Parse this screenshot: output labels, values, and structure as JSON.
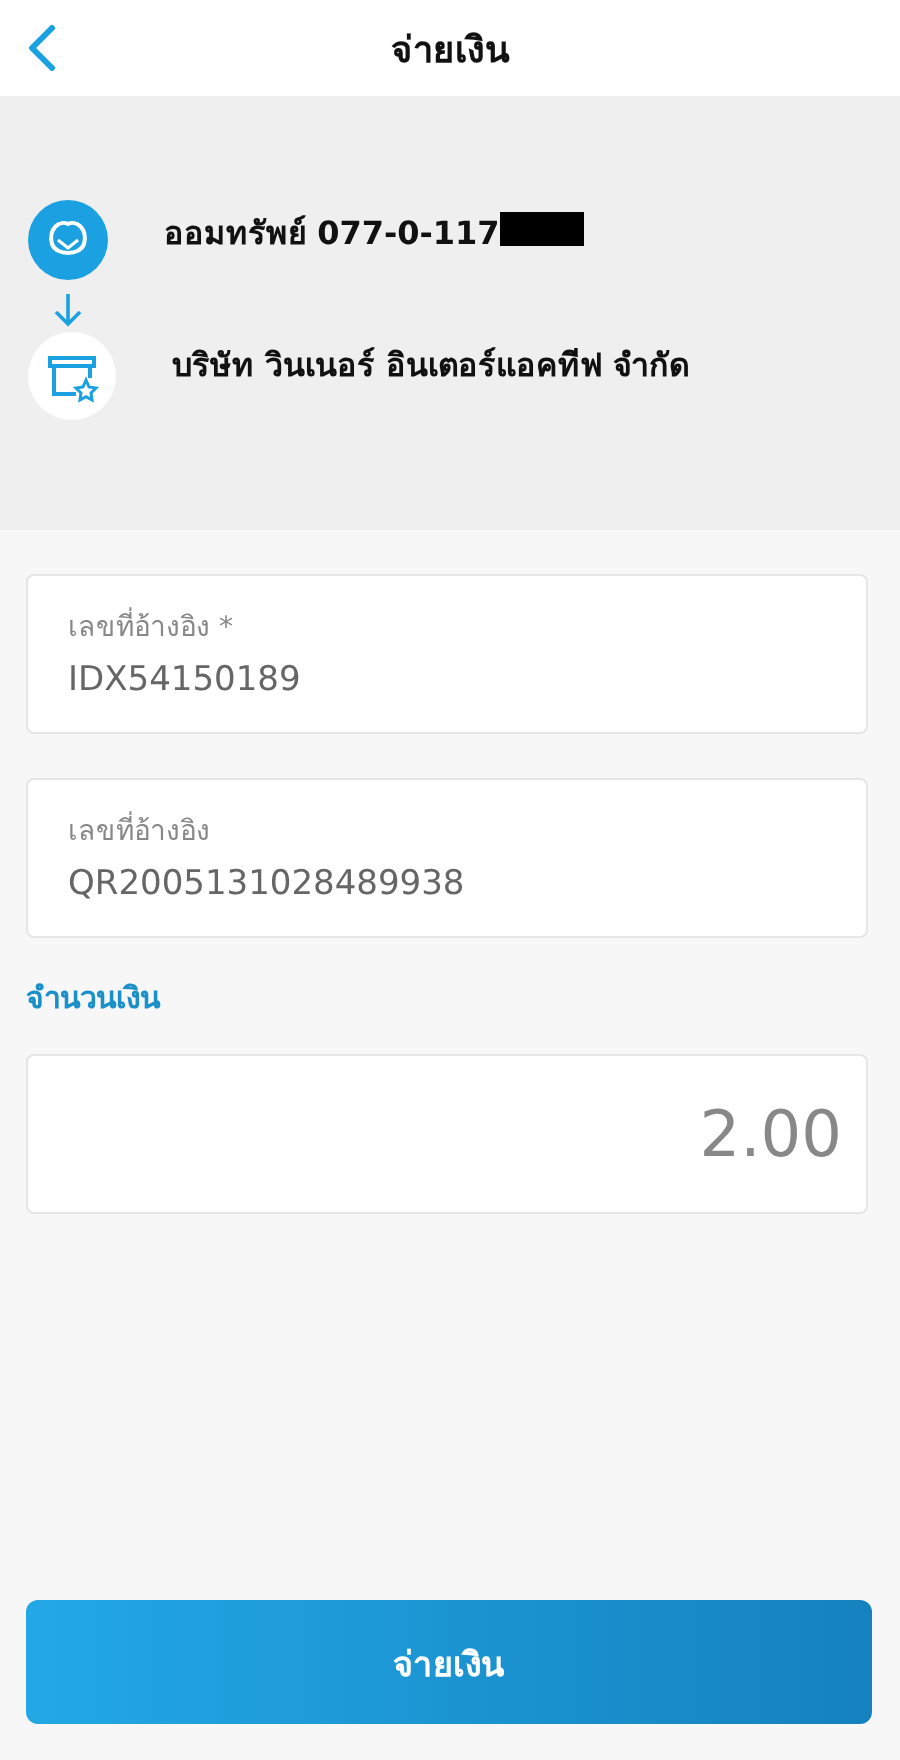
{
  "header": {
    "title": "จ่ายเงิน"
  },
  "transfer": {
    "from": {
      "account": "ออมทรัพย์ 077-0-117",
      "redacted": true
    },
    "to": {
      "name": "บริษัท วินเนอร์ อินเตอร์แอคทีฟ จำกัด"
    }
  },
  "fields": [
    {
      "label": "เลขที่อ้างอิง *",
      "value": "IDX54150189"
    },
    {
      "label": "เลขที่อ้างอิง",
      "value": "QR2005131028489938"
    }
  ],
  "amount": {
    "label": "จำนวนเงิน",
    "value": "2.00"
  },
  "pay_button": "จ่ายเงิน"
}
